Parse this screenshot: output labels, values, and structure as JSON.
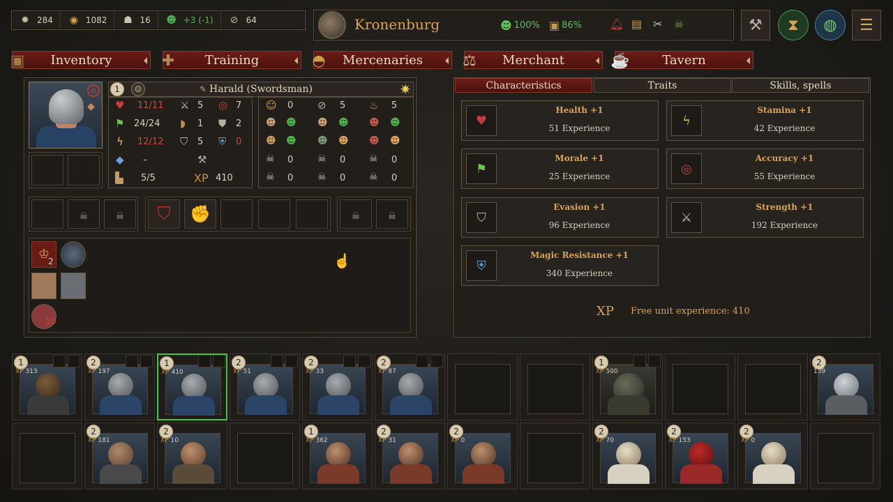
{
  "resources": [
    {
      "icon": "sun-icon",
      "value": "284"
    },
    {
      "icon": "gold-icon",
      "value": "1082"
    },
    {
      "icon": "population-icon",
      "value": "16"
    },
    {
      "icon": "mood-icon",
      "value": "+3 (-1)"
    },
    {
      "icon": "eye-icon",
      "value": "64"
    }
  ],
  "city": {
    "name": "Kronenburg",
    "stat1": "100%",
    "stat2": "86%"
  },
  "tabs": [
    "Inventory",
    "Training",
    "Mercenaries",
    "Merchant",
    "Tavern"
  ],
  "unit": {
    "level": "1",
    "name": "Harald (Swordsman)",
    "health": "11/11",
    "morale": "24/24",
    "stamina": "12/12",
    "mana": "–",
    "ap": "5/5",
    "attack": "5",
    "defense_1": "1",
    "shield": "5",
    "accuracy": "7",
    "armor": "2",
    "magic_res": "0",
    "xp_label": "XP",
    "xp": "410",
    "resist_grid": [
      "0",
      "5",
      "5",
      "0",
      "0",
      "0",
      "0",
      "0",
      "0"
    ]
  },
  "right_tabs": [
    "Characteristics",
    "Traits",
    "Skills, spells"
  ],
  "characteristics": [
    {
      "name": "Health +1",
      "xp": "51 Experience",
      "icon": "heart-icon"
    },
    {
      "name": "Stamina +1",
      "xp": "42 Experience",
      "icon": "lightning-icon"
    },
    {
      "name": "Morale +1",
      "xp": "25 Experience",
      "icon": "flag-icon"
    },
    {
      "name": "Accuracy +1",
      "xp": "55 Experience",
      "icon": "target-icon"
    },
    {
      "name": "Evasion +1",
      "xp": "96 Experience",
      "icon": "shield-icon"
    },
    {
      "name": "Strength +1",
      "xp": "192 Experience",
      "icon": "sword-icon"
    },
    {
      "name": "Magic Resistance +1",
      "xp": "340 Experience",
      "icon": "magic-shield-icon"
    }
  ],
  "free_xp": {
    "label": "XP",
    "text": "Free unit experience: 410"
  },
  "badge_count": "2",
  "wound_count": "10",
  "roster_row1": [
    {
      "lvl": "1",
      "xp": "313"
    },
    {
      "lvl": "2",
      "xp": "197"
    },
    {
      "lvl": "1",
      "xp": "410"
    },
    {
      "lvl": "2",
      "xp": "51"
    },
    {
      "lvl": "2",
      "xp": "33"
    },
    {
      "lvl": "2",
      "xp": "87"
    },
    {
      "lvl": "1",
      "xp": "500"
    },
    {
      "lvl": "2",
      "xp": "139"
    }
  ],
  "roster_row2": [
    {
      "lvl": "2",
      "xp": "181"
    },
    {
      "lvl": "2",
      "xp": "10"
    },
    {
      "lvl": "1",
      "xp": "362"
    },
    {
      "lvl": "2",
      "xp": "31"
    },
    {
      "lvl": "2",
      "xp": "0"
    },
    {
      "lvl": "2",
      "xp": "70"
    },
    {
      "lvl": "2",
      "xp": "153"
    },
    {
      "lvl": "2",
      "xp": "0"
    }
  ]
}
